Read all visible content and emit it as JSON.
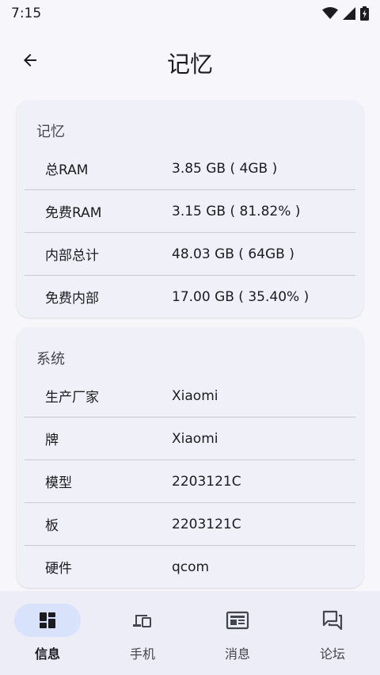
{
  "status_bar": {
    "time": "7:15"
  },
  "app_bar": {
    "title": "记忆"
  },
  "memory_card": {
    "header": "记忆",
    "rows": [
      {
        "label": "总RAM",
        "value": "3.85 GB ( 4GB )"
      },
      {
        "label": "免费RAM",
        "value": "3.15 GB ( 81.82% )"
      },
      {
        "label": "内部总计",
        "value": "48.03 GB ( 64GB )"
      },
      {
        "label": "免费内部",
        "value": "17.00 GB ( 35.40% )"
      }
    ]
  },
  "system_card": {
    "header": "系统",
    "rows": [
      {
        "label": "生产厂家",
        "value": "Xiaomi"
      },
      {
        "label": "牌",
        "value": "Xiaomi"
      },
      {
        "label": "模型",
        "value": "2203121C"
      },
      {
        "label": "板",
        "value": "2203121C"
      },
      {
        "label": "硬件",
        "value": "qcom"
      }
    ]
  },
  "bottom_nav": {
    "items": [
      {
        "label": "信息",
        "icon": "dashboard-icon",
        "active": true
      },
      {
        "label": "手机",
        "icon": "devices-icon",
        "active": false
      },
      {
        "label": "消息",
        "icon": "newspaper-icon",
        "active": false
      },
      {
        "label": "论坛",
        "icon": "forum-icon",
        "active": false
      }
    ]
  },
  "colors": {
    "background": "#f7f6fb",
    "card": "#eff0f8",
    "nav_background": "#ecedf6",
    "nav_active_pill": "#d8e2fb"
  }
}
